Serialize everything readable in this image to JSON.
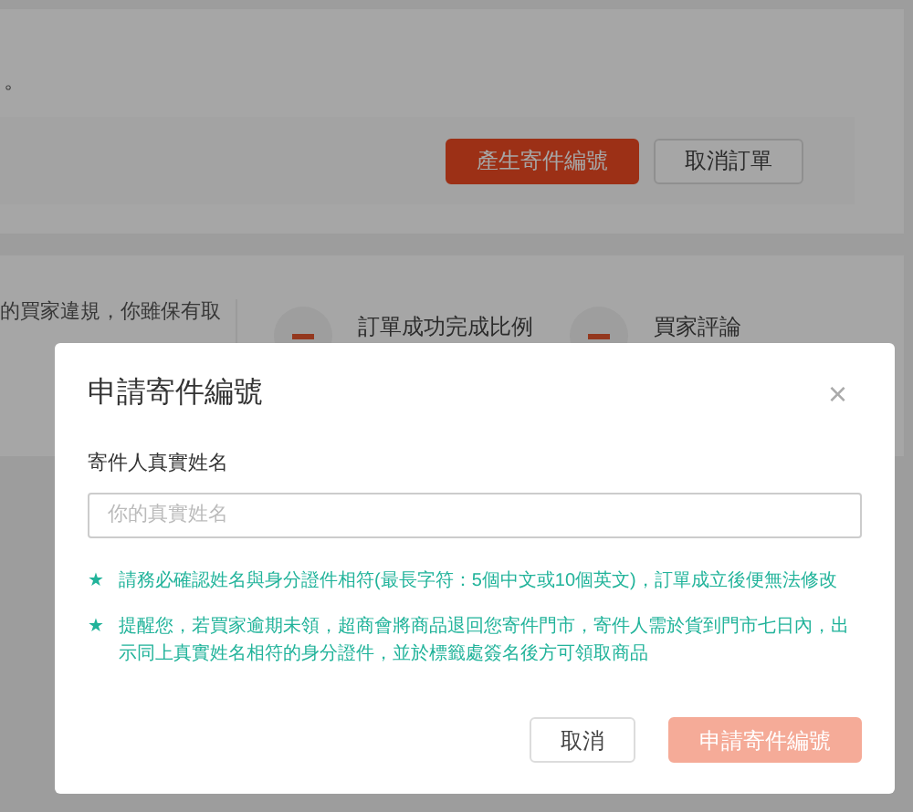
{
  "background": {
    "notice_text": "。",
    "actions": [
      {
        "label": "產生寄件編號",
        "kind": "primary"
      },
      {
        "label": "取消訂單",
        "kind": "secondary"
      }
    ],
    "info_lines": [
      "的買家違規，你雖保有取"
    ],
    "stats": [
      {
        "label": "訂單成功完成比例"
      },
      {
        "label": "買家評論"
      }
    ]
  },
  "dialog": {
    "title": "申請寄件編號",
    "close": "×",
    "field": {
      "label": "寄件人真實姓名",
      "placeholder": "你的真實姓名"
    },
    "notes": [
      {
        "mark": "★",
        "text": "請務必確認姓名與身分證件相符(最長字符：5個中文或10個英文)，訂單成立後便無法修改"
      },
      {
        "mark": "★",
        "text": "提醒您，若買家逾期未領，超商會將商品退回您寄件門市，寄件人需於貨到門市七日內，出示同上真實姓名相符的身分證件，並於標籤處簽名後方可領取商品"
      }
    ],
    "buttons": [
      {
        "label": "取消",
        "kind": "secondary",
        "disabled": false
      },
      {
        "label": "申請寄件編號",
        "kind": "primary",
        "disabled": true
      }
    ]
  }
}
